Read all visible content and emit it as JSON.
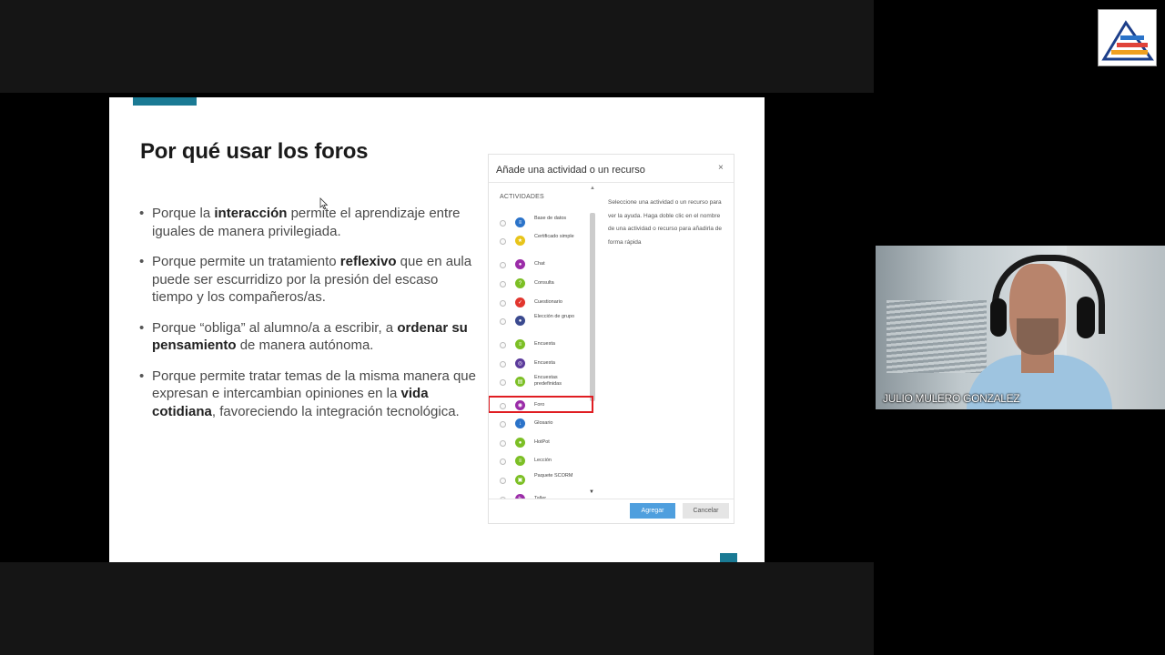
{
  "slide": {
    "title": "Por qué usar los foros",
    "bullets": [
      {
        "parts": [
          {
            "t": "Porque la "
          },
          {
            "t": "interacción",
            "b": true
          },
          {
            "t": " permite el aprendizaje entre iguales de manera privilegiada."
          }
        ]
      },
      {
        "parts": [
          {
            "t": "Porque permite un tratamiento "
          },
          {
            "t": "reflexivo",
            "b": true
          },
          {
            "t": " que en aula puede ser escurridizo por la presión del escaso tiempo y los compañeros/as."
          }
        ]
      },
      {
        "parts": [
          {
            "t": "Porque “obliga” al alumno/a a escribir, a "
          },
          {
            "t": "ordenar su pensamiento",
            "b": true
          },
          {
            "t": " de manera autónoma."
          }
        ]
      },
      {
        "parts": [
          {
            "t": "Porque permite tratar temas de la misma manera que expresan e intercambian opiniones en la "
          },
          {
            "t": "vida cotidiana",
            "b": true
          },
          {
            "t": ", favoreciendo la integración tecnológica."
          }
        ]
      }
    ]
  },
  "dialog": {
    "title": "Añade una actividad o un recurso",
    "close_glyph": "×",
    "section_label": "ACTIVIDADES",
    "help_text": "Seleccione una actividad o un recurso para ver la ayuda. Haga doble clic en el nombre de una actividad o recurso para añadirla de forma rápida",
    "activities": [
      {
        "label": "Base de datos",
        "icon": "database-icon",
        "color": "#2b73c9",
        "glyph": "≡"
      },
      {
        "label": "Certificado simple",
        "icon": "certificate-icon",
        "color": "#e8c41a",
        "glyph": "★"
      },
      {
        "label": "Chat",
        "icon": "chat-icon",
        "color": "#9b2ca8",
        "glyph": "●"
      },
      {
        "label": "Consulta",
        "icon": "choice-icon",
        "color": "#7cbf25",
        "glyph": "?"
      },
      {
        "label": "Cuestionario",
        "icon": "quiz-icon",
        "color": "#e2362e",
        "glyph": "✓"
      },
      {
        "label": "Elección de grupo",
        "icon": "group-choice-icon",
        "color": "#3b4a8f",
        "glyph": "●"
      },
      {
        "label": "Encuesta",
        "icon": "feedback-icon",
        "color": "#7cbf25",
        "glyph": "≡"
      },
      {
        "label": "Encuesta",
        "icon": "survey-icon",
        "color": "#5b3a9b",
        "glyph": "◎"
      },
      {
        "label": "Encuestas predefinidas",
        "icon": "predefined-survey-icon",
        "color": "#7cbf25",
        "glyph": "▤"
      },
      {
        "label": "Foro",
        "icon": "forum-icon",
        "color": "#9b2ca8",
        "glyph": "◉"
      },
      {
        "label": "Glosario",
        "icon": "glossary-icon",
        "color": "#2b73c9",
        "glyph": "↓"
      },
      {
        "label": "HotPot",
        "icon": "hotpot-icon",
        "color": "#7cbf25",
        "glyph": "●"
      },
      {
        "label": "Lección",
        "icon": "lesson-icon",
        "color": "#7cbf25",
        "glyph": "≡"
      },
      {
        "label": "Paquete SCORM",
        "icon": "scorm-icon",
        "color": "#7cbf25",
        "glyph": "▣"
      },
      {
        "label": "Taller",
        "icon": "workshop-icon",
        "color": "#9b2ca8",
        "glyph": "✎"
      }
    ],
    "selected_index": 9,
    "add_label": "Agregar",
    "cancel_label": "Cancelar"
  },
  "webcam": {
    "name": "JULIO MULERO GONZALEZ"
  },
  "colors": {
    "accent": "#1a7a94",
    "highlight": "#e01d22",
    "primary_button": "#4f9fde"
  }
}
